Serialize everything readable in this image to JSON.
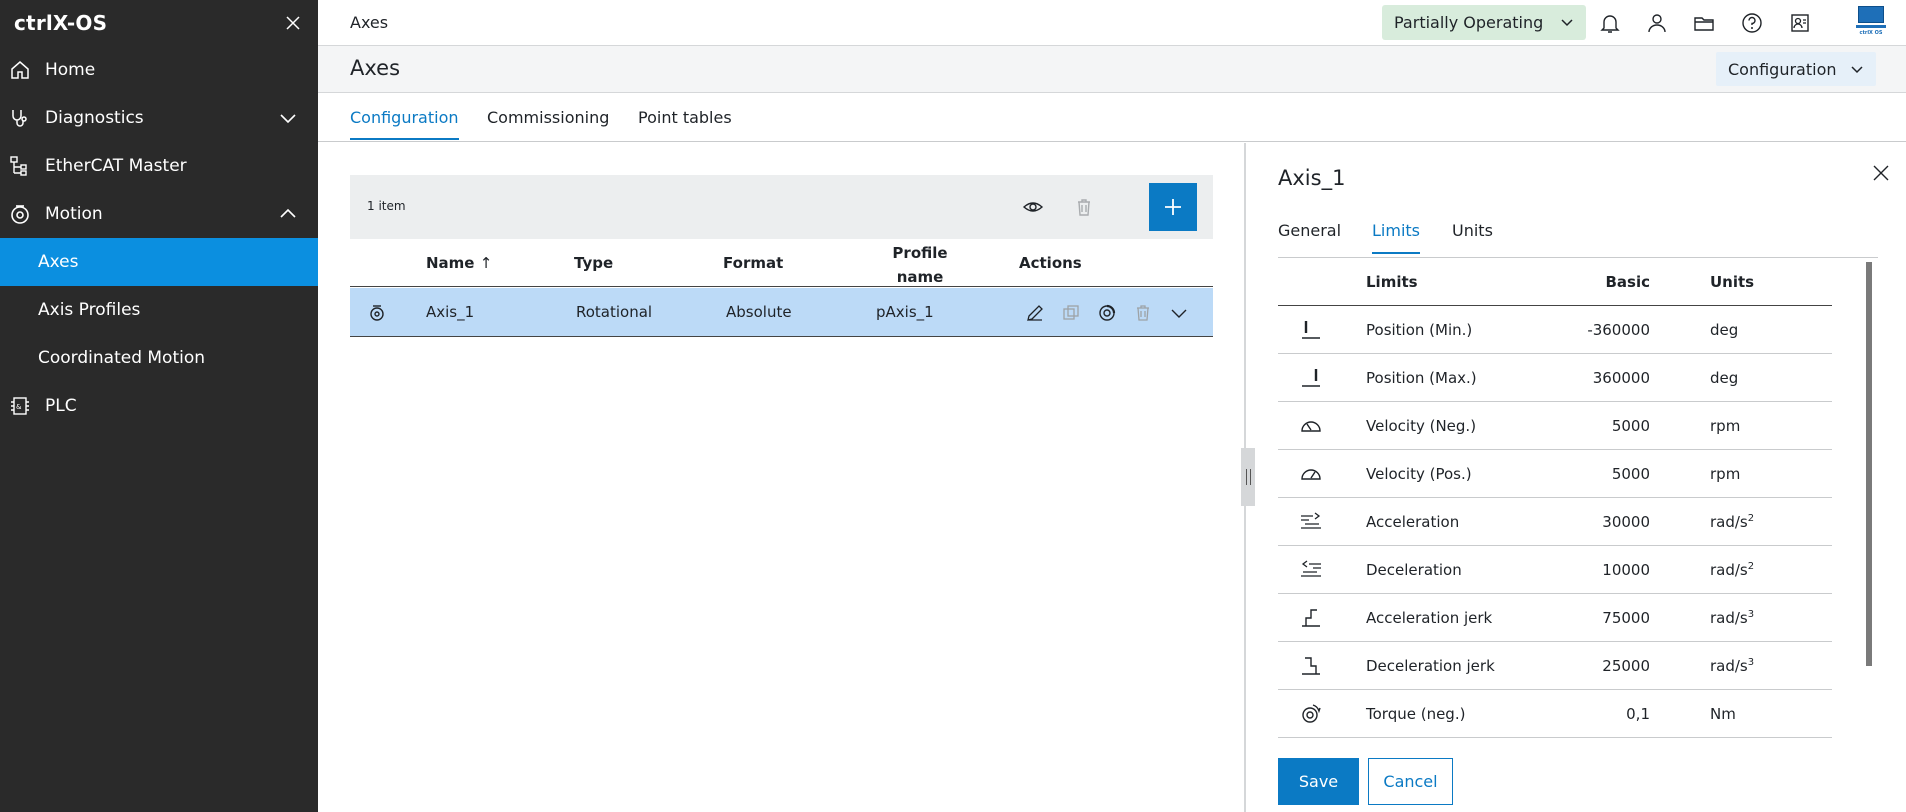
{
  "app": {
    "title": "ctrlX-OS"
  },
  "sidebar": {
    "items": [
      {
        "label": "Home"
      },
      {
        "label": "Diagnostics"
      },
      {
        "label": "EtherCAT Master"
      },
      {
        "label": "Motion"
      },
      {
        "label": "Axes"
      },
      {
        "label": "Axis Profiles"
      },
      {
        "label": "Coordinated Motion"
      },
      {
        "label": "PLC"
      }
    ]
  },
  "topbar": {
    "breadcrumb": "Axes",
    "status": "Partially Operating",
    "logo_text": "ctrlX OS"
  },
  "page": {
    "title": "Axes",
    "view_select": "Configuration"
  },
  "tabs": [
    {
      "label": "Configuration"
    },
    {
      "label": "Commissioning"
    },
    {
      "label": "Point tables"
    }
  ],
  "table": {
    "item_count": "1 item",
    "columns": {
      "name": "Name",
      "name_sort": "↑",
      "type": "Type",
      "format": "Format",
      "profile": "Profile",
      "profile2": "name",
      "actions": "Actions"
    },
    "rows": [
      {
        "name": "Axis_1",
        "type": "Rotational",
        "format": "Absolute",
        "profile": "pAxis_1"
      }
    ]
  },
  "detail": {
    "title": "Axis_1",
    "tabs": [
      {
        "label": "General"
      },
      {
        "label": "Limits"
      },
      {
        "label": "Units"
      }
    ],
    "columns": {
      "limits": "Limits",
      "basic": "Basic",
      "units": "Units"
    },
    "rows": [
      {
        "icon": "position-min-icon",
        "label": "Position (Min.)",
        "value": "-360000",
        "unit": "deg",
        "sup": ""
      },
      {
        "icon": "position-max-icon",
        "label": "Position (Max.)",
        "value": "360000",
        "unit": "deg",
        "sup": ""
      },
      {
        "icon": "velocity-neg-icon",
        "label": "Velocity (Neg.)",
        "value": "5000",
        "unit": "rpm",
        "sup": ""
      },
      {
        "icon": "velocity-pos-icon",
        "label": "Velocity (Pos.)",
        "value": "5000",
        "unit": "rpm",
        "sup": ""
      },
      {
        "icon": "acceleration-icon",
        "label": "Acceleration",
        "value": "30000",
        "unit": "rad/s",
        "sup": "2"
      },
      {
        "icon": "deceleration-icon",
        "label": "Deceleration",
        "value": "10000",
        "unit": "rad/s",
        "sup": "2"
      },
      {
        "icon": "acceleration-jerk-icon",
        "label": "Acceleration jerk",
        "value": "75000",
        "unit": "rad/s",
        "sup": "3"
      },
      {
        "icon": "deceleration-jerk-icon",
        "label": "Deceleration jerk",
        "value": "25000",
        "unit": "rad/s",
        "sup": "3"
      },
      {
        "icon": "torque-neg-icon",
        "label": "Torque (neg.)",
        "value": "0,1",
        "unit": "Nm",
        "sup": ""
      }
    ],
    "save_label": "Save",
    "cancel_label": "Cancel"
  },
  "colors": {
    "sidebar_bg": "#2a2a2a",
    "active_nav": "#0b8fe0",
    "accent": "#0b7ac4",
    "status_bg": "#d8ecdc",
    "selected_row": "#bcdaf7"
  }
}
